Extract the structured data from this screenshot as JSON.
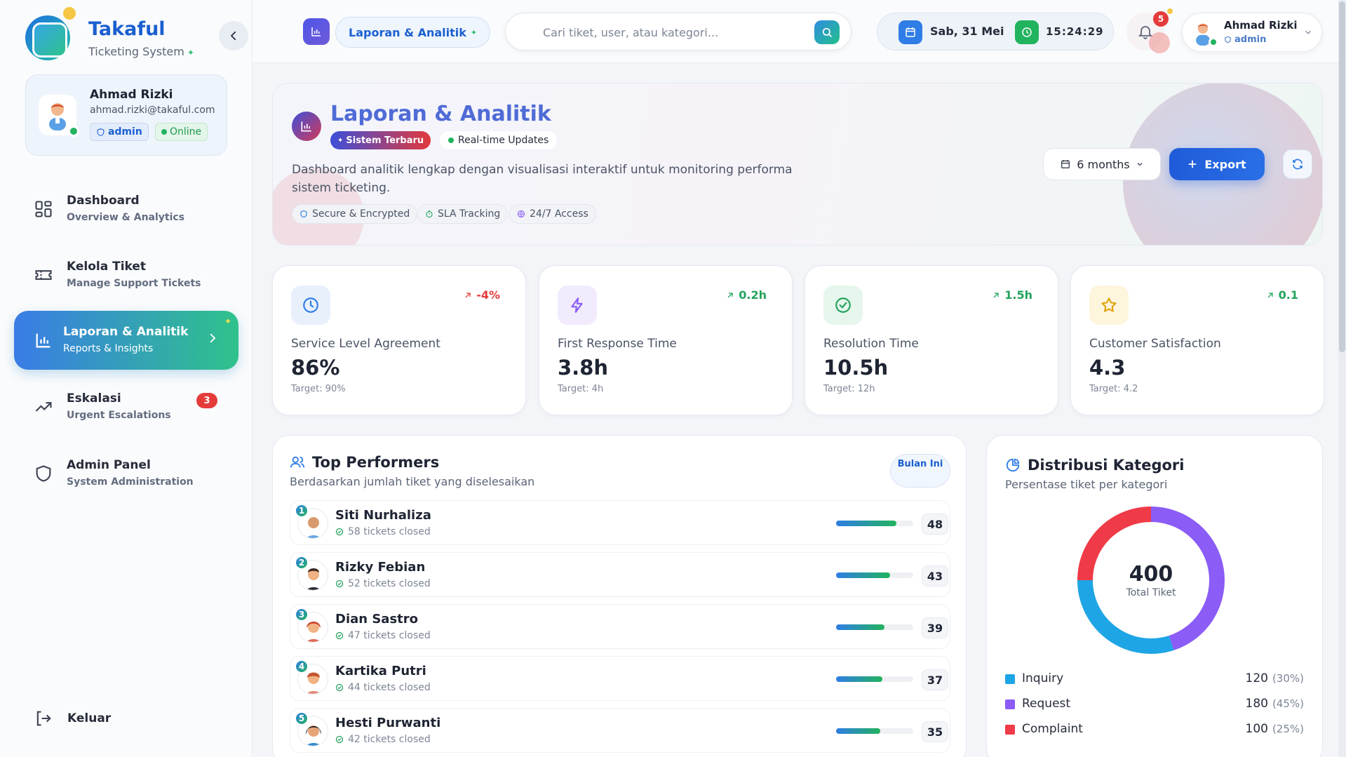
{
  "brand": {
    "title": "Takaful",
    "subtitle": "Ticketing System"
  },
  "profile": {
    "name": "Ahmad Rizki",
    "email": "ahmad.rizki@takaful.com",
    "role": "admin",
    "status": "Online"
  },
  "nav": [
    {
      "label": "Dashboard",
      "sub": "Overview & Analytics"
    },
    {
      "label": "Kelola Tiket",
      "sub": "Manage Support Tickets"
    },
    {
      "label": "Laporan & Analitik",
      "sub": "Reports & Insights"
    },
    {
      "label": "Eskalasi",
      "sub": "Urgent Escalations",
      "badge": "3"
    },
    {
      "label": "Admin Panel",
      "sub": "System Administration"
    }
  ],
  "logout": "Keluar",
  "topbar": {
    "crumb": "Laporan & Analitik",
    "search_placeholder": "Cari tiket, user, atau kategori...",
    "date": "Sab, 31 Mei",
    "time": "15:24:29",
    "notif_count": "5",
    "user_name": "Ahmad Rizki",
    "user_role": "admin"
  },
  "hero": {
    "title": "Laporan & Analitik",
    "tag": "Sistem Terbaru",
    "realtime": "Real-time Updates",
    "description": "Dashboard analitik lengkap dengan visualisasi interaktif untuk monitoring performa sistem ticketing.",
    "chips": [
      "Secure & Encrypted",
      "SLA Tracking",
      "24/7 Access"
    ],
    "period": "6 months",
    "export": "Export"
  },
  "kpis": [
    {
      "label": "Service Level Agreement",
      "value": "86%",
      "target": "Target: 90%",
      "trend": "-4%",
      "trend_color": "#e53b3b",
      "icon": "clock-icon",
      "color": "#2f7de6",
      "bg": "#e8f0fc"
    },
    {
      "label": "First Response Time",
      "value": "3.8h",
      "target": "Target: 4h",
      "trend": "0.2h",
      "trend_color": "#22a35e",
      "icon": "lightning-icon",
      "color": "#8b5cf6",
      "bg": "#f1ebfd"
    },
    {
      "label": "Resolution Time",
      "value": "10.5h",
      "target": "Target: 12h",
      "trend": "1.5h",
      "trend_color": "#22a35e",
      "icon": "check-circle-icon",
      "color": "#22a35e",
      "bg": "#e7f6ec"
    },
    {
      "label": "Customer Satisfaction",
      "value": "4.3",
      "target": "Target: 4.2",
      "trend": "0.1",
      "trend_color": "#22a35e",
      "icon": "star-icon",
      "color": "#e0a411",
      "bg": "#fdf5dc"
    }
  ],
  "performers": {
    "title": "Top Performers",
    "subtitle": "Berdasarkan jumlah tiket yang diselesaikan",
    "badge": "Bulan Ini",
    "rows": [
      {
        "rank": "1",
        "name": "Siti Nurhaliza",
        "sub": "58 tickets closed",
        "value": "48",
        "fill": 1.0
      },
      {
        "rank": "2",
        "name": "Rizky Febian",
        "sub": "52 tickets closed",
        "value": "43",
        "fill": 0.9
      },
      {
        "rank": "3",
        "name": "Dian Sastro",
        "sub": "47 tickets closed",
        "value": "39",
        "fill": 0.81
      },
      {
        "rank": "4",
        "name": "Kartika Putri",
        "sub": "44 tickets closed",
        "value": "37",
        "fill": 0.77
      },
      {
        "rank": "5",
        "name": "Hesti Purwanti",
        "sub": "42 tickets closed",
        "value": "35",
        "fill": 0.73
      }
    ]
  },
  "distribution": {
    "title": "Distribusi Kategori",
    "subtitle": "Persentase tiket per kategori",
    "total": "400",
    "total_label": "Total Tiket",
    "items": [
      {
        "name": "Inquiry",
        "value": "120",
        "pct": "(30%)",
        "color": "#1ea5e6",
        "share": 0.3
      },
      {
        "name": "Request",
        "value": "180",
        "pct": "(45%)",
        "color": "#8b5cf6",
        "share": 0.45
      },
      {
        "name": "Complaint",
        "value": "100",
        "pct": "(25%)",
        "color": "#ef3b47",
        "share": 0.25
      }
    ]
  }
}
